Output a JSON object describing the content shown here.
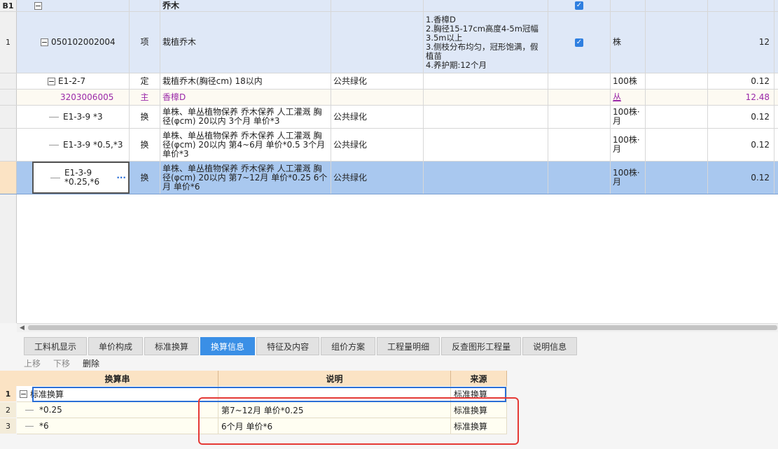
{
  "main_grid": {
    "header_row": {
      "num": "B1",
      "name": "乔木"
    },
    "rows": [
      {
        "num": "1",
        "code": "050102002004",
        "type": "项",
        "name": "栽植乔木",
        "feature": "1.香樟D\n2.胸径15-17cm高度4-5m冠幅\n3.5m以上\n3.侧枝分布均匀，冠形饱满，假植苗\n4.养护期:12个月",
        "unit": "株",
        "qty": "12"
      },
      {
        "num": "",
        "code": "E1-2-7",
        "type": "定",
        "name": "栽植乔木(胸径cm) 18以内",
        "spec": "公共绿化",
        "unit": "100株",
        "qty": "0.12"
      },
      {
        "num": "",
        "code": "3203006005",
        "type": "主",
        "name": "香樟D",
        "unit": "丛",
        "qty": "12.48"
      },
      {
        "num": "",
        "code": "E1-3-9 *3",
        "type": "换",
        "name": "单株、单丛植物保养 乔木保养 人工灌溉 胸径(φcm) 20以内  3个月 单价*3",
        "spec": "公共绿化",
        "unit": "100株·月",
        "qty": "0.12"
      },
      {
        "num": "",
        "code": "E1-3-9 *0.5,*3",
        "type": "换",
        "name": "单株、单丛植物保养 乔木保养 人工灌溉 胸径(φcm) 20以内  第4~6月 单价*0.5  3个月 单价*3",
        "spec": "公共绿化",
        "unit": "100株·月",
        "qty": "0.12"
      },
      {
        "num": "",
        "code": "E1-3-9\n*0.25,*6",
        "code_more": "···",
        "type": "换",
        "name": "单株、单丛植物保养 乔木保养 人工灌溉 胸径(φcm) 20以内  第7~12月 单价*0.25  6个月 单价*6",
        "spec": "公共绿化",
        "unit": "100株·月",
        "qty": "0.12"
      }
    ]
  },
  "tabs": [
    "工料机显示",
    "单价构成",
    "标准换算",
    "换算信息",
    "特征及内容",
    "组价方案",
    "工程量明细",
    "反查图形工程量",
    "说明信息"
  ],
  "active_tab": "换算信息",
  "toolbar": {
    "up": "上移",
    "down": "下移",
    "delete": "删除"
  },
  "bottom_table": {
    "headers": [
      "换算串",
      "说明",
      "来源"
    ],
    "rows": [
      {
        "num": "1",
        "expr": "标准换算",
        "desc": "",
        "src": "标准换算"
      },
      {
        "num": "2",
        "expr": "*0.25",
        "desc": "第7~12月 单价*0.25",
        "src": "标准换算"
      },
      {
        "num": "3",
        "expr": "*6",
        "desc": "6个月 单价*6",
        "src": "标准换算"
      }
    ]
  }
}
